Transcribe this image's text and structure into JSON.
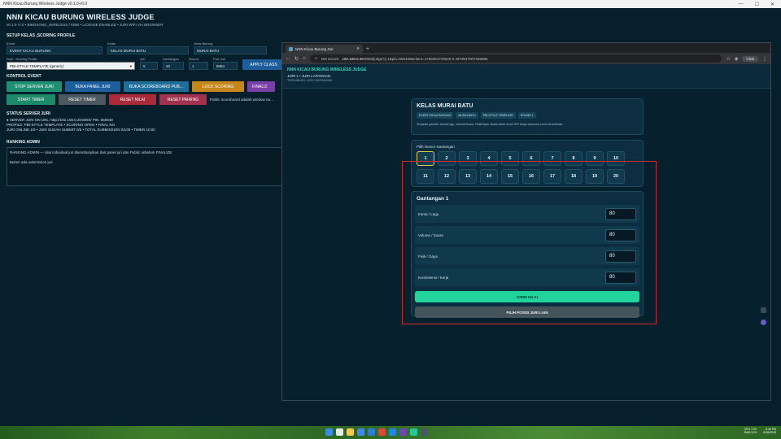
{
  "app": {
    "window_title": "NNN Kicau Burung Wireless Judge v0.1.0-r0.0",
    "title": "NNN KICAU BURUNG WIRELESS JUDGE",
    "subtitle": "v0.1.0-r7.0  •  BIRDSONG_WIRELESS / KBW  •  LICENSE ENABLED  •  JURI WIFI VIA BROWSER",
    "setup_heading": "SETUP KELAS ,SCORING PROFILE",
    "fields": {
      "event_label": "Event",
      "event_value": "EVENT KICAU BURUNG",
      "kelas_label": "Kelas",
      "kelas_value": "KELAS MURAI BATU",
      "jenis_label": "Jenis Burung",
      "jenis_value": "MURAI BATU",
      "rule_label": "Rule / Scoring Profile",
      "rule_value": "PBI-STYLE TEMPLATE (generic)",
      "juri_label": "Juri",
      "juri_value": "5",
      "gantangan_label": "Gantangan",
      "gantangan_value": "20",
      "round_label": "Round",
      "round_value": "1",
      "port_label": "Port Juri",
      "port_value": "8094",
      "apply_button": "APPLY CLASS"
    },
    "kontrol_heading": "KONTROL EVENT",
    "buttons_row1": [
      "STOP SERVER JURI",
      "BUKA PANEL JURI",
      "BUKA SCOREBOARD PUB...",
      "LOCK SCORING",
      "FINALIZ"
    ],
    "buttons_row2": [
      "START TIMER",
      "RESET TIMER",
      "RESET NILAI",
      "RESET PAIRING"
    ],
    "public_note": "Public Scoreboard adalah window na…",
    "status_heading": "STATUS SERVER JURI",
    "status_lines": [
      "● SERVER JURI ON    URL: http://192.168.0.28:8094/   PIN: 659348",
      "PROFILE: PBI-STYLE TEMPLATE   •   SCORING OPEN   •   FINAL NO",
      "JURI ONLINE 1/5   •   JURI SUDAH SUBMIT 0/5   •   TOTAL SUBMISSION 0/100   •   TIMER 10:00"
    ],
    "ranking_heading": "RANKING ADMIN",
    "ranking_lines": [
      "RANKING ADMIN — nilai individual juri disembunyikan dari panel juri dan Public sebelum FINALIZE",
      "",
      "Belum ada submission juri."
    ]
  },
  "browser": {
    "tab_title": "NNN Kicau Burung Juri",
    "not_secure": "Not secure",
    "url_host": "192.168.0.28",
    "url_rest": ":8094/judge?j=1&pin=659348&client=1756351729525-0.4973047007330886",
    "profile_label": "Chat"
  },
  "page": {
    "header_title": "NNN KICAU BURUNG WIRELESS JUDGE",
    "header_sub": "JURI 1 • JURI LAPANGAN",
    "header_sub2": "TERHUBUNG • 6/20 GANTANGAN",
    "class_title": "KELAS MURAI BATU",
    "chips": [
      "EVENT KICAU BURUNG",
      "MURAI BATU",
      "PBI-STYLE TEMPLATE",
      "ROUND 1"
    ],
    "class_desc": "Template generik: Irama/Lagu, Volume/Suara, Fisik/Gaya. Bukan tabel resmi ORI tanpa dokumen event terverifikasi.",
    "gantangan_label": "Pilih Nomor Gantangan",
    "numbers": [
      "1",
      "2",
      "3",
      "4",
      "5",
      "6",
      "7",
      "8",
      "9",
      "10",
      "11",
      "12",
      "13",
      "14",
      "15",
      "16",
      "17",
      "18",
      "19",
      "20"
    ],
    "selected_number": "1",
    "score_title": "Gantangan 1",
    "criteria": [
      {
        "label": "Irama / Lagu",
        "value": "80"
      },
      {
        "label": "Volume / Suara",
        "value": "80"
      },
      {
        "label": "Fisik / Gaya",
        "value": "80"
      },
      {
        "label": "Konsistensi / Kerja",
        "value": "80"
      }
    ],
    "kirim_button": "KIRIM NILAI",
    "pilih_button": "PILIH POSISI JURI LAIN"
  },
  "taskbar": {
    "time": "5:36 PM",
    "date": "8/28/2025",
    "temp": "CPU 71%",
    "mem": "RAM 21%"
  },
  "colors": {
    "accent_teal": "#22d39c",
    "stop_server": "#1f8f72",
    "buka_panel": "#1d5f9c",
    "buka_scoreboard": "#1f6e9a",
    "lock_scoring": "#c5861a",
    "finalize": "#7b3fa8",
    "start_timer": "#1d8a6a",
    "reset_timer": "#4b5860",
    "reset_nilai": "#a92a3a",
    "reset_pairing": "#a3324f",
    "annotation_box": "#d3282b"
  }
}
